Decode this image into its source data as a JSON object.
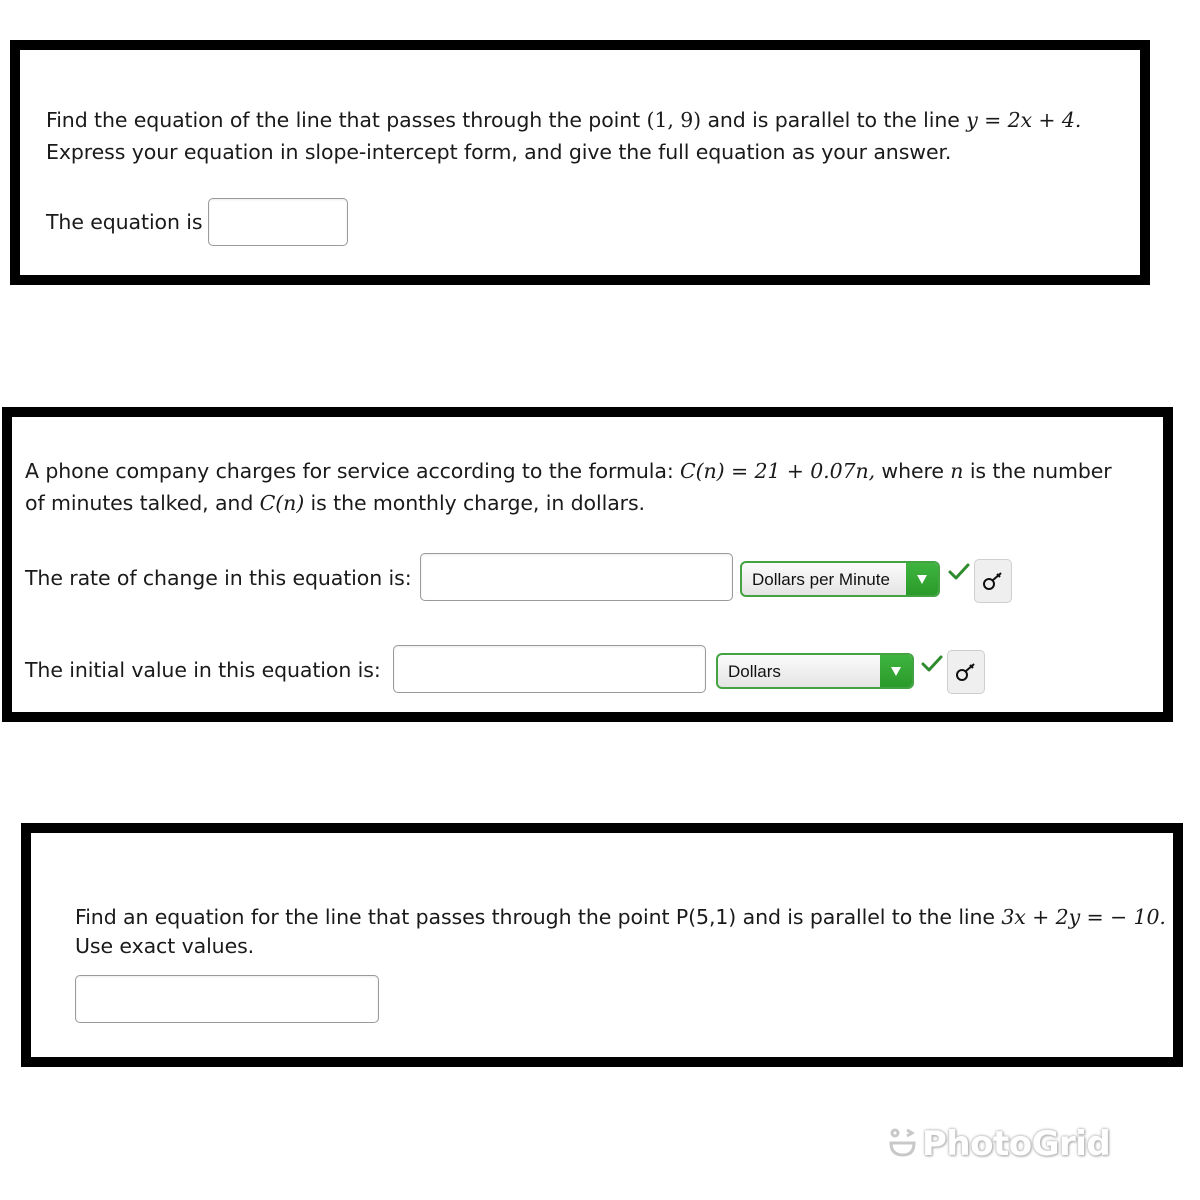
{
  "question1": {
    "line1_pre": "Find the equation of the line that passes through the point ",
    "point": "(1, 9)",
    "line1_mid": " and is parallel to the line ",
    "given_line": "y = 2x + 4.",
    "line2": "Express your equation in slope-intercept form, and give the full equation as your answer.",
    "answer_label": "The equation is",
    "answer_value": ""
  },
  "question2": {
    "line1_pre": "A phone company charges for service according to the formula: ",
    "formula": "C(n) = 21 + 0.07n,",
    "line1_mid": " where ",
    "var_n": "n",
    "line1_post": " is the number",
    "line2_pre": "of minutes talked, and ",
    "var_cn": "C(n)",
    "line2_post": " is the monthly charge, in dollars.",
    "rate_label": "The rate of change in this equation is:",
    "rate_value": "",
    "rate_unit_selected": "Dollars per Minute",
    "initial_label": "The initial value in this equation is:",
    "initial_value": "",
    "initial_unit_selected": "Dollars",
    "icons": {
      "check": "checkmark-icon",
      "key": "key-icon",
      "dropdown": "triangle-down-icon"
    },
    "colors": {
      "accent": "#3aa63a",
      "check": "#2e8b2e"
    }
  },
  "question3": {
    "line1_pre": "Find an equation for the line that passes through the point P(5,1) and is parallel to the line ",
    "given_line": "3x + 2y =  − 10.",
    "line2": "Use exact values.",
    "answer_value": ""
  },
  "watermark": {
    "text": "PhotoGrid",
    "icon": "smiley-wink-icon"
  }
}
